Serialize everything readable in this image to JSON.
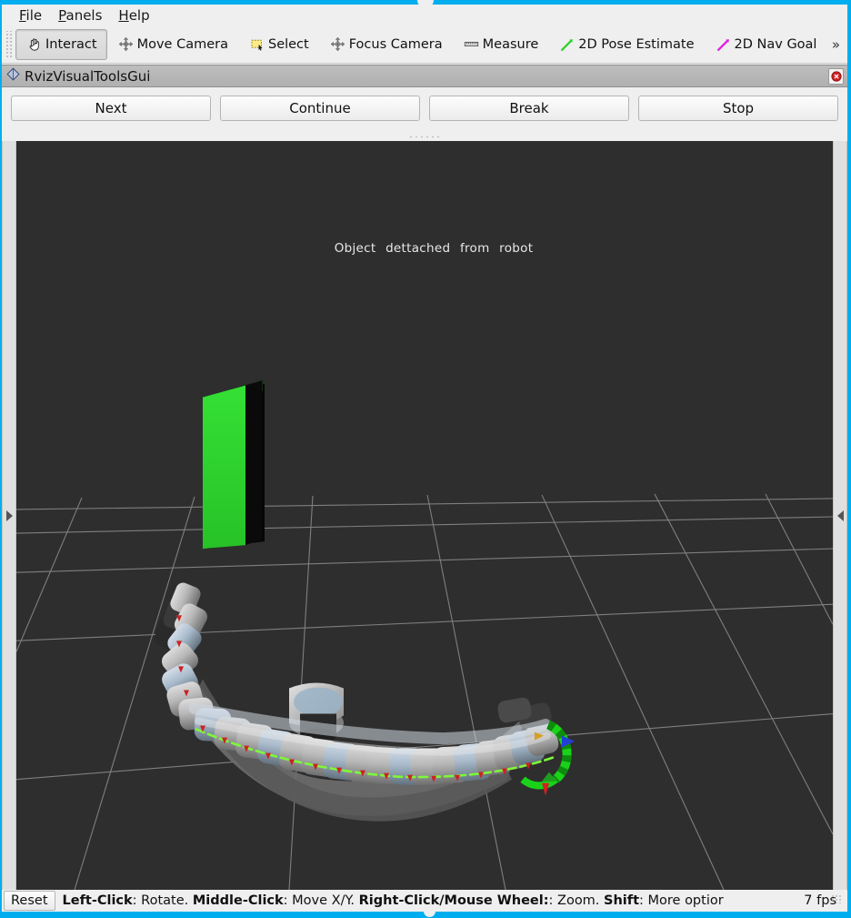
{
  "window": {
    "accent_color": "#00AEEF",
    "chrome_color": "#efefef"
  },
  "menubar": {
    "items": [
      {
        "name": "file",
        "label": "File",
        "mnemonic": "F"
      },
      {
        "name": "panels",
        "label": "Panels",
        "mnemonic": "P"
      },
      {
        "name": "help",
        "label": "Help",
        "mnemonic": "H"
      }
    ]
  },
  "toolbar": {
    "buttons": [
      {
        "name": "interact",
        "label": "Interact",
        "icon": "hand-cursor-icon",
        "active": true
      },
      {
        "name": "move-camera",
        "label": "Move Camera",
        "icon": "move-camera-icon",
        "active": false
      },
      {
        "name": "select",
        "label": "Select",
        "icon": "select-rect-icon",
        "active": false
      },
      {
        "name": "focus-camera",
        "label": "Focus Camera",
        "icon": "focus-camera-icon",
        "active": false
      },
      {
        "name": "measure",
        "label": "Measure",
        "icon": "ruler-icon",
        "active": false
      },
      {
        "name": "pose-estimate",
        "label": "2D Pose Estimate",
        "icon": "green-arrow-icon",
        "active": false
      },
      {
        "name": "nav-goal",
        "label": "2D Nav Goal",
        "icon": "magenta-arrow-icon",
        "active": false
      }
    ],
    "overflow_label": "»"
  },
  "panel": {
    "title": "RvizVisualToolsGui",
    "title_icon": "diamond-icon",
    "close_icon": "close-circle-icon",
    "close_color": "#cc2222",
    "buttons": [
      {
        "name": "next",
        "label": "Next"
      },
      {
        "name": "continue",
        "label": "Continue"
      },
      {
        "name": "break",
        "label": "Break"
      },
      {
        "name": "stop",
        "label": "Stop"
      }
    ]
  },
  "viewport": {
    "background_color": "#2e2e2e",
    "grid_color": "#9a9a9a",
    "scene_label_words": [
      "Object",
      "dettached",
      "from",
      "robot"
    ],
    "left_handle_icon": "chevron-right-icon",
    "right_handle_icon": "chevron-left-icon",
    "object": {
      "name": "green-box",
      "color": "#2fd22f",
      "shadow_color": "#050505"
    },
    "robot": {
      "name": "snake-manipulator",
      "segment_count": 30,
      "trajectory_color": "#7ef73a",
      "waypoint_color": "#cc2222"
    },
    "interactive_marker": {
      "ring_color": "#19d219",
      "x_arrow_color": "#d42020",
      "y_arrow_color": "#1e9e1e",
      "z_arrow_color": "#2040d4"
    }
  },
  "statusbar": {
    "reset_label": "Reset",
    "help_parts": [
      {
        "bold": true,
        "text": "Left-Click"
      },
      {
        "bold": false,
        "text": ": Rotate.  "
      },
      {
        "bold": true,
        "text": "Middle-Click"
      },
      {
        "bold": false,
        "text": ": Move X/Y.  "
      },
      {
        "bold": true,
        "text": "Right-Click/Mouse Wheel:"
      },
      {
        "bold": false,
        "text": ": Zoom.  "
      },
      {
        "bold": true,
        "text": "Shift"
      },
      {
        "bold": false,
        "text": ": More optior"
      }
    ],
    "fps": "7 fps"
  }
}
